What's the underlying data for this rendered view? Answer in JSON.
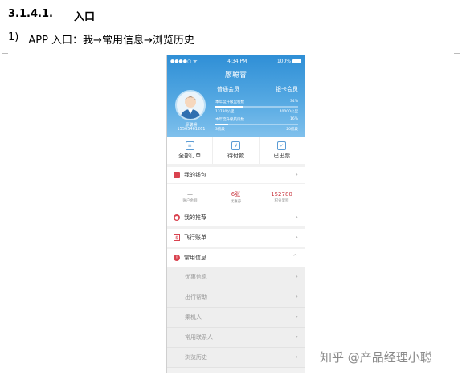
{
  "doc": {
    "section_number": "3.1.4.1.",
    "section_title": "入口",
    "step_number": "1)",
    "step_text": "APP 入口：我→常用信息→浏览历史"
  },
  "phone": {
    "status_bar": {
      "signal": "●●●●○ ᯤ",
      "time": "4:34 PM",
      "battery": "100%"
    },
    "title": "廖聪睿",
    "user": {
      "name": "廖聪睿",
      "phone": "15565461261"
    },
    "member_levels": [
      "普通会员",
      "银卡会员"
    ],
    "progress": [
      {
        "label": "本年度升级里程数",
        "percent_text": "34%",
        "sub_left": "13780公里",
        "sub_right": "40000公里",
        "fraction": 0.34
      },
      {
        "label": "本年度升级航段数",
        "percent_text": "16%",
        "sub_left": "3航段",
        "sub_right": "20航段",
        "fraction": 0.16
      }
    ],
    "orders": [
      "全部订单",
      "待付款",
      "已出票"
    ],
    "wallet": {
      "label": "我的钱包",
      "stats": [
        {
          "value": "—",
          "label": "账户余额"
        },
        {
          "value": "6张",
          "label": "优惠券"
        },
        {
          "value": "152780",
          "label": "积分里程"
        }
      ]
    },
    "recommend": "我的推荐",
    "flight_bill": "飞行账单",
    "common_info": "常用信息",
    "sub_items": [
      "优惠信息",
      "出行帮助",
      "乘机人",
      "常用联系人",
      "浏览历史"
    ]
  },
  "watermark": "知乎 @产品经理小聪",
  "colors": {
    "header_top": "#2f8fd6",
    "accent_red": "#c8343d"
  }
}
